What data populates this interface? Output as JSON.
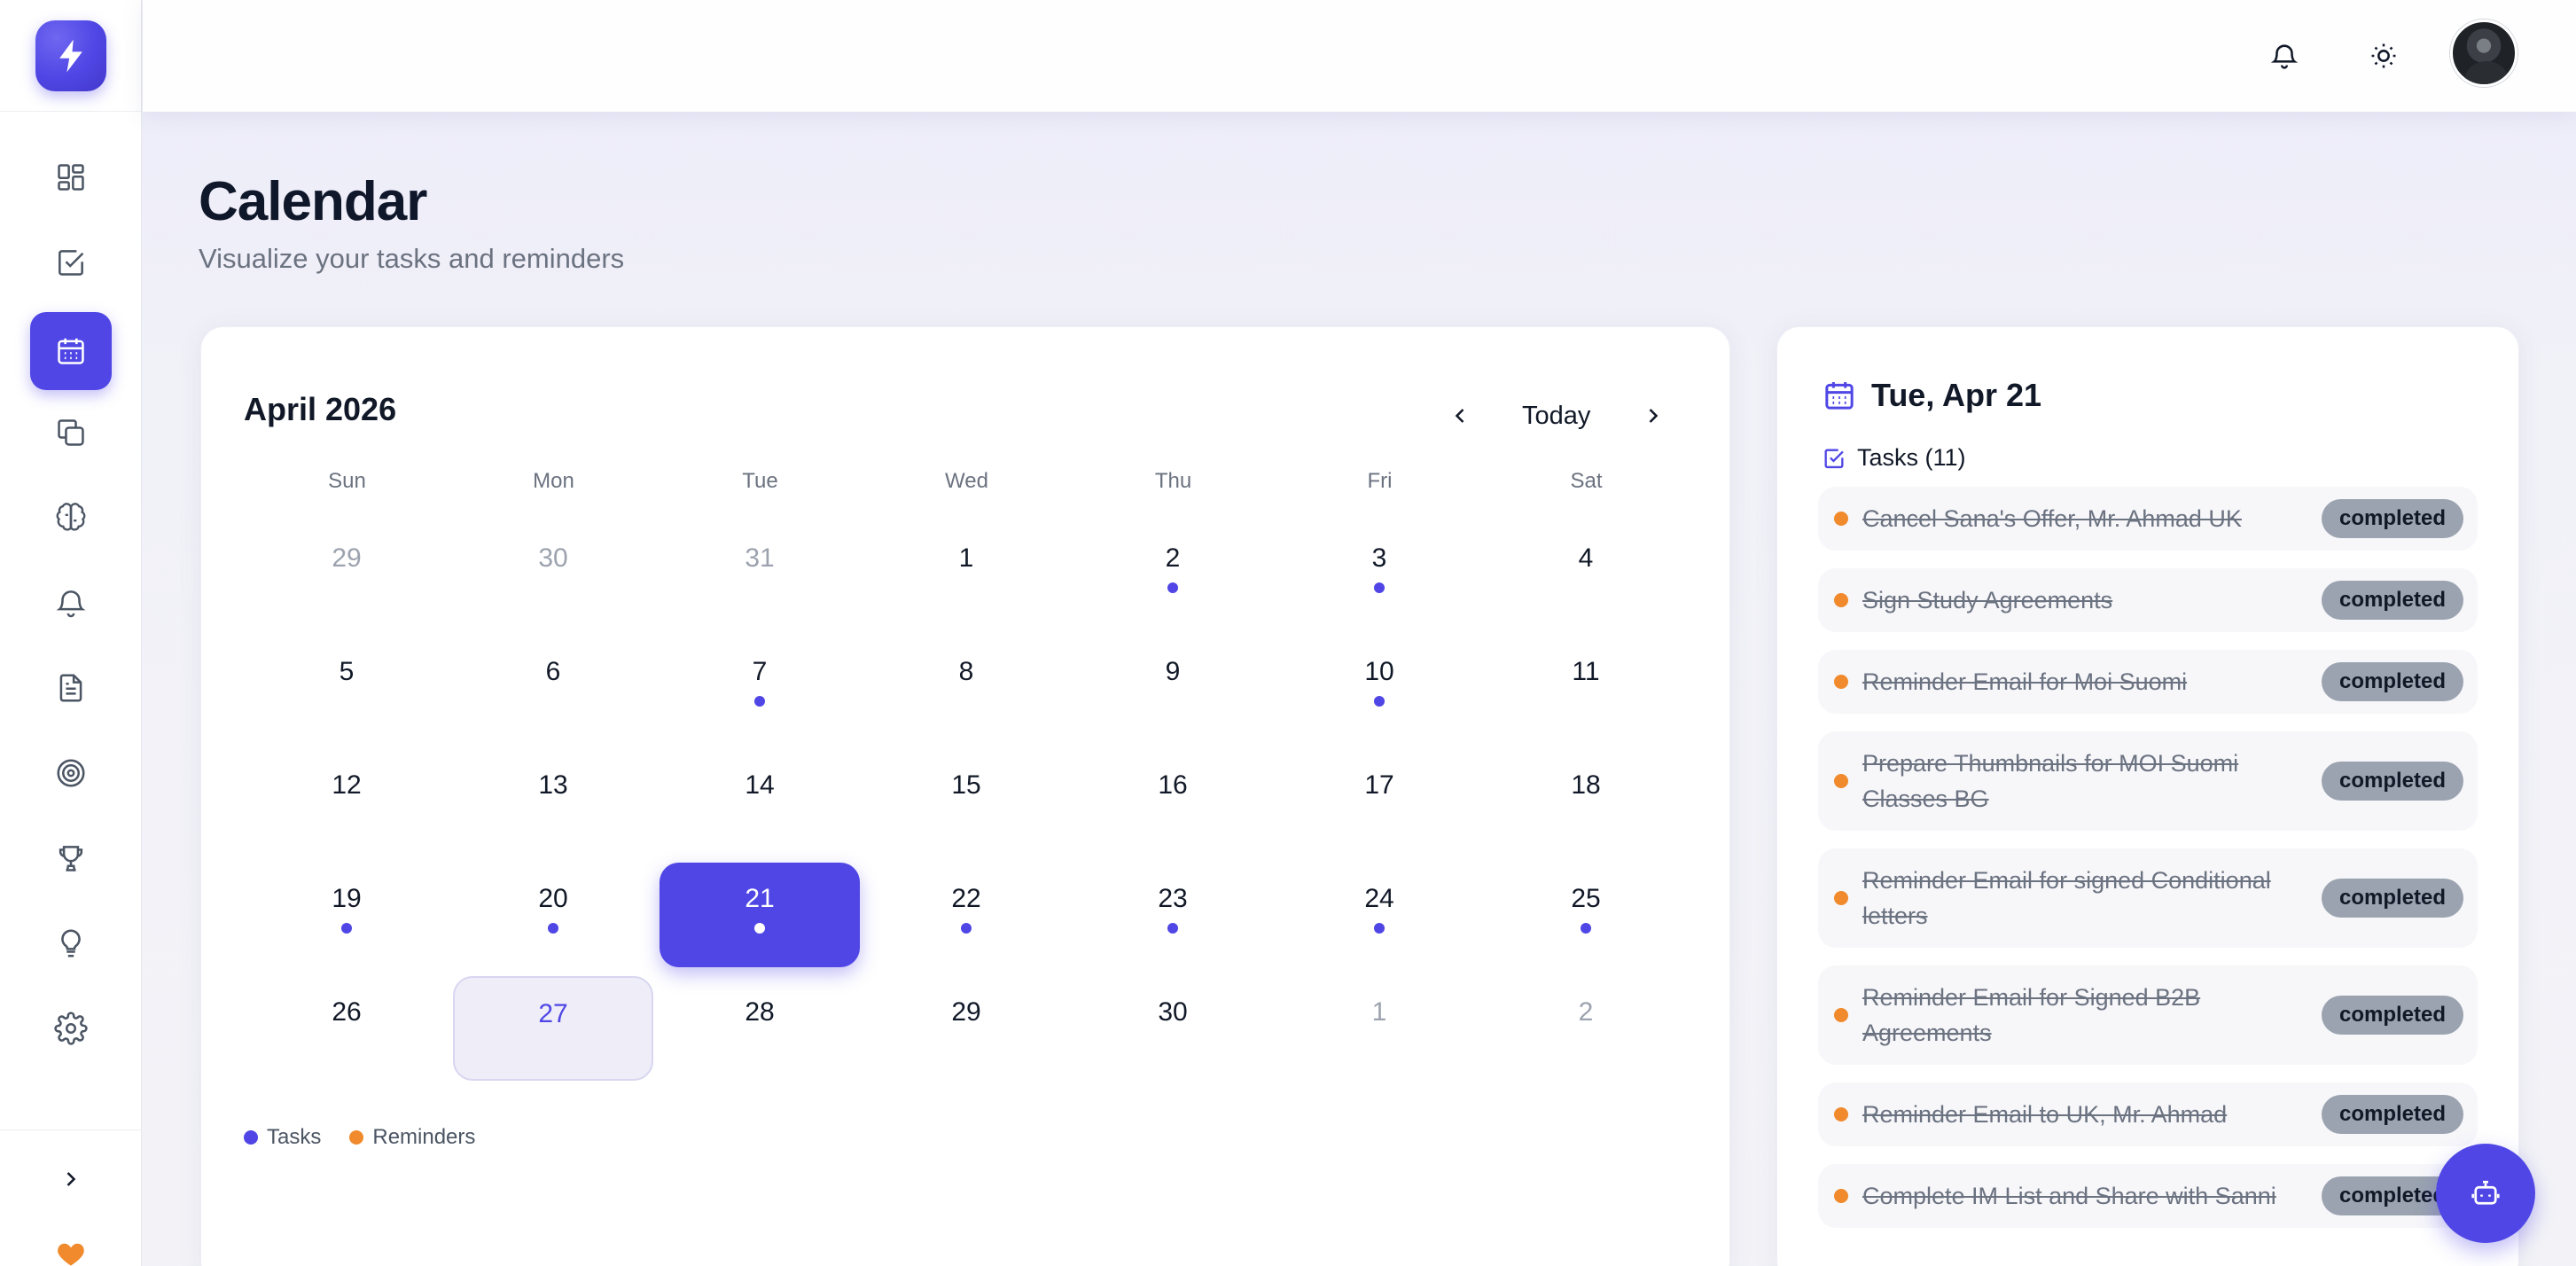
{
  "page": {
    "title": "Calendar",
    "subtitle": "Visualize your tasks and reminders"
  },
  "sidebar": {
    "items": [
      {
        "name": "dashboard",
        "icon": "dashboard-icon",
        "active": false
      },
      {
        "name": "tasks",
        "icon": "checkbox-icon",
        "active": false
      },
      {
        "name": "calendar",
        "icon": "calendar-icon",
        "active": true
      },
      {
        "name": "copy",
        "icon": "copy-icon",
        "active": false
      },
      {
        "name": "brain",
        "icon": "brain-icon",
        "active": false
      },
      {
        "name": "reminders",
        "icon": "bell-icon",
        "active": false
      },
      {
        "name": "documents",
        "icon": "document-icon",
        "active": false
      },
      {
        "name": "goals",
        "icon": "target-icon",
        "active": false
      },
      {
        "name": "achievements",
        "icon": "trophy-icon",
        "active": false
      },
      {
        "name": "ideas",
        "icon": "lightbulb-icon",
        "active": false
      },
      {
        "name": "settings",
        "icon": "gear-icon",
        "active": false
      }
    ]
  },
  "calendar": {
    "month_label": "April 2026",
    "today_label": "Today",
    "weekdays": [
      "Sun",
      "Mon",
      "Tue",
      "Wed",
      "Thu",
      "Fri",
      "Sat"
    ],
    "weeks": [
      [
        {
          "d": "29",
          "m": true,
          "dot": false
        },
        {
          "d": "30",
          "m": true,
          "dot": false
        },
        {
          "d": "31",
          "m": true,
          "dot": false
        },
        {
          "d": "1",
          "m": false,
          "dot": false
        },
        {
          "d": "2",
          "m": false,
          "dot": true
        },
        {
          "d": "3",
          "m": false,
          "dot": true
        },
        {
          "d": "4",
          "m": false,
          "dot": false
        }
      ],
      [
        {
          "d": "5",
          "m": false,
          "dot": false
        },
        {
          "d": "6",
          "m": false,
          "dot": false
        },
        {
          "d": "7",
          "m": false,
          "dot": true
        },
        {
          "d": "8",
          "m": false,
          "dot": false
        },
        {
          "d": "9",
          "m": false,
          "dot": false
        },
        {
          "d": "10",
          "m": false,
          "dot": true
        },
        {
          "d": "11",
          "m": false,
          "dot": false
        }
      ],
      [
        {
          "d": "12",
          "m": false,
          "dot": false
        },
        {
          "d": "13",
          "m": false,
          "dot": false
        },
        {
          "d": "14",
          "m": false,
          "dot": false
        },
        {
          "d": "15",
          "m": false,
          "dot": false
        },
        {
          "d": "16",
          "m": false,
          "dot": false
        },
        {
          "d": "17",
          "m": false,
          "dot": false
        },
        {
          "d": "18",
          "m": false,
          "dot": false
        }
      ],
      [
        {
          "d": "19",
          "m": false,
          "dot": true
        },
        {
          "d": "20",
          "m": false,
          "dot": true
        },
        {
          "d": "21",
          "m": false,
          "dot": true,
          "selected": true
        },
        {
          "d": "22",
          "m": false,
          "dot": true
        },
        {
          "d": "23",
          "m": false,
          "dot": true
        },
        {
          "d": "24",
          "m": false,
          "dot": true
        },
        {
          "d": "25",
          "m": false,
          "dot": true
        }
      ],
      [
        {
          "d": "26",
          "m": false,
          "dot": false
        },
        {
          "d": "27",
          "m": false,
          "dot": false,
          "today": true
        },
        {
          "d": "28",
          "m": false,
          "dot": false
        },
        {
          "d": "29",
          "m": false,
          "dot": false
        },
        {
          "d": "30",
          "m": false,
          "dot": false
        },
        {
          "d": "1",
          "m": true,
          "dot": false
        },
        {
          "d": "2",
          "m": true,
          "dot": false
        }
      ]
    ],
    "legend": [
      {
        "label": "Tasks",
        "color": "#4f46e5"
      },
      {
        "label": "Reminders",
        "color": "#f08a2c"
      }
    ]
  },
  "side_panel": {
    "date": "Tue, Apr 21",
    "tasks_header": "Tasks (11)",
    "tasks": [
      {
        "text": "Cancel Sana's Offer, Mr. Ahmad UK",
        "status": "completed",
        "lines": 1
      },
      {
        "text": "Sign Study Agreements",
        "status": "completed",
        "lines": 1
      },
      {
        "text": "Reminder Email for Moi Suomi",
        "status": "completed",
        "lines": 1
      },
      {
        "text": "Prepare Thumbnails for MOI Suomi Classes BG",
        "status": "completed",
        "lines": 2
      },
      {
        "text": "Reminder Email for signed Conditional letters",
        "status": "completed",
        "lines": 2
      },
      {
        "text": "Reminder Email for Signed B2B Agreements",
        "status": "completed",
        "lines": 2
      },
      {
        "text": "Reminder Email to UK, Mr. Ahmad",
        "status": "completed",
        "lines": 1
      },
      {
        "text": "Complete IM List and Share with Sanni",
        "status": "completed",
        "lines": 1
      }
    ]
  },
  "colors": {
    "accent": "#4f46e5",
    "reminder": "#f08a2c",
    "badge": "#9aa3af"
  }
}
